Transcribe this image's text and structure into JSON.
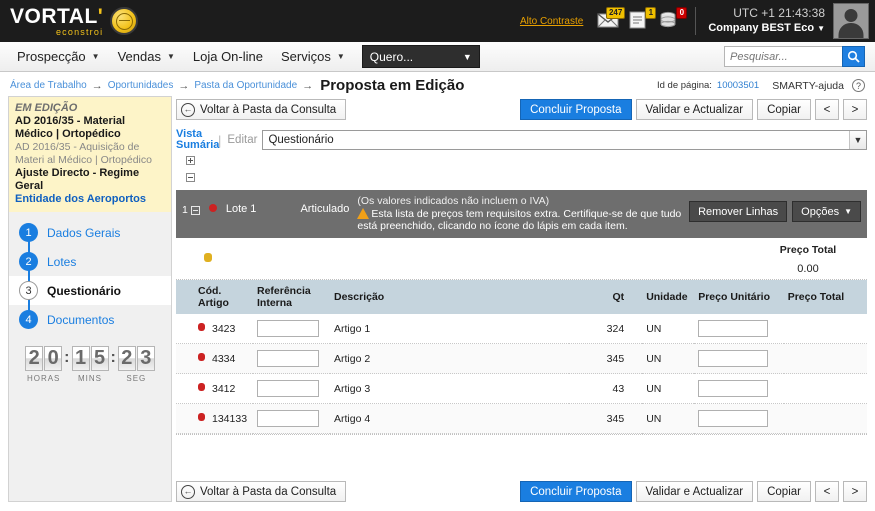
{
  "header": {
    "logo_main": "VORTAL",
    "logo_sub": "econstroi",
    "alto_contraste": "Alto Contraste",
    "icons": [
      {
        "name": "mail-icon",
        "badge": "247"
      },
      {
        "name": "document-icon",
        "badge": "1"
      },
      {
        "name": "database-icon",
        "badge": "0"
      }
    ],
    "utc": "UTC +1 21:43:38",
    "company": "Company BEST Eco",
    "company_caret": "▼"
  },
  "nav": {
    "items": [
      {
        "label": "Prospecção",
        "caret": "▼"
      },
      {
        "label": "Vendas",
        "caret": "▼"
      },
      {
        "label": "Loja On-line",
        "caret": ""
      },
      {
        "label": "Serviços",
        "caret": "▼"
      }
    ],
    "quero_label": "Quero...",
    "quero_caret": "▼",
    "search_placeholder": "Pesquisar...",
    "search_value": ""
  },
  "breadcrumb": {
    "items": [
      "Área de Trabalho",
      "Oportunidades",
      "Pasta da Oportunidade"
    ],
    "arrow": "→",
    "current": "Proposta em Edição",
    "page_id_label": "Id de página:",
    "page_id": "10003501",
    "smarty": "SMARTY-ajuda",
    "help": "?"
  },
  "sidebar": {
    "status": "EM EDIÇÃO",
    "title": "AD 2016/35 - Material Médico | Ortopédico",
    "description": "AD 2016/35 - Aquisição de Materi al Médico | Ortopédico",
    "type": "Ajuste Directo - Regime Geral",
    "entity": "Entidade dos Aeroportos",
    "steps": [
      {
        "num": "1",
        "label": "Dados Gerais",
        "active": false
      },
      {
        "num": "2",
        "label": "Lotes",
        "active": false
      },
      {
        "num": "3",
        "label": "Questionário",
        "active": true
      },
      {
        "num": "4",
        "label": "Documentos",
        "active": false
      }
    ],
    "timer": {
      "hours": "20",
      "mins": "15",
      "secs": "23",
      "colon": ":",
      "hours_label": "HORAS",
      "mins_label": "MINS",
      "secs_label": "SEG"
    }
  },
  "toolbar": {
    "back_label": "Voltar à Pasta da Consulta",
    "back_icon": "←",
    "concluir_label": "Concluir Proposta",
    "validar_label": "Validar e Actualizar",
    "copiar_label": "Copiar",
    "prev_label": "<",
    "next_label": ">"
  },
  "viewrow": {
    "vista_line1": "Vista",
    "vista_line2": "Sumária",
    "separator": "|",
    "editar_label": "Editar",
    "selected_option": "Questionário",
    "caret": "▼"
  },
  "lote": {
    "index": "1",
    "name": "Lote 1",
    "articulado": "Articulado",
    "note": "(Os valores indicados não incluem o IVA)",
    "warning": "Esta lista de preços tem requisitos extra. Certifique-se de que tudo está preenchido, clicando no ícone do lápis em cada item.",
    "remover_label": "Remover Linhas",
    "opcoes_label": "Opções",
    "opcoes_caret": "▼"
  },
  "totals": {
    "label": "Preço Total",
    "value": "0.00"
  },
  "table": {
    "columns": [
      "Cód. Artigo",
      "Referência Interna",
      "Descrição",
      "Qt",
      "Unidade",
      "Preço Unitário",
      "Preço Total"
    ],
    "rows": [
      {
        "cod": "3423",
        "ref": "",
        "desc": "Artigo 1",
        "qt": "324",
        "unidade": "UN",
        "preco_unitario": "",
        "preco_total": ""
      },
      {
        "cod": "4334",
        "ref": "",
        "desc": "Artigo 2",
        "qt": "345",
        "unidade": "UN",
        "preco_unitario": "",
        "preco_total": ""
      },
      {
        "cod": "3412",
        "ref": "",
        "desc": "Artigo 3",
        "qt": "43",
        "unidade": "UN",
        "preco_unitario": "",
        "preco_total": ""
      },
      {
        "cod": "134133",
        "ref": "",
        "desc": "Artigo 4",
        "qt": "345",
        "unidade": "UN",
        "preco_unitario": "",
        "preco_total": ""
      }
    ]
  },
  "colors": {
    "accent_blue": "#1a7ee0",
    "header_black": "#1c1c1c",
    "brand_yellow": "#f3c21b",
    "lote_gray": "#6e6e6e",
    "table_header": "#c5d4dd",
    "status_red": "#cc2222",
    "sidebar_yellow": "#fdf4c8"
  }
}
